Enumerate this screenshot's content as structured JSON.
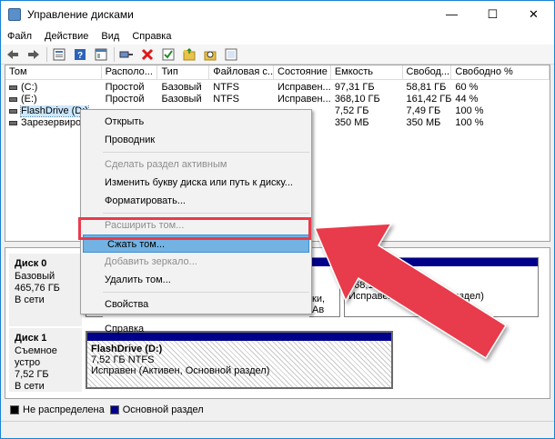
{
  "window": {
    "title": "Управление дисками",
    "minimize": "—",
    "maximize": "☐",
    "close": "✕"
  },
  "menu": [
    "Файл",
    "Действие",
    "Вид",
    "Справка"
  ],
  "toolbar_icons": [
    "back-icon",
    "forward-icon",
    "properties-icon",
    "help-icon",
    "console-icon",
    "connect-icon",
    "delete-icon",
    "check-icon",
    "folder-icon",
    "search-folder-icon",
    "refresh-icon"
  ],
  "table": {
    "headers": [
      "Том",
      "Располо...",
      "Тип",
      "Файловая с...",
      "Состояние",
      "Емкость",
      "Свобод...",
      "Свободно %"
    ],
    "rows": [
      {
        "volume": "(C:)",
        "layout": "Простой",
        "type": "Базовый",
        "fs": "NTFS",
        "status": "Исправен...",
        "capacity": "97,31 ГБ",
        "free": "58,81 ГБ",
        "free_pct": "60 %"
      },
      {
        "volume": "(E:)",
        "layout": "Простой",
        "type": "Базовый",
        "fs": "NTFS",
        "status": "Исправен...",
        "capacity": "368,10 ГБ",
        "free": "161,42 ГБ",
        "free_pct": "44 %"
      },
      {
        "volume": "FlashDrive (D:)",
        "layout": "",
        "type": "",
        "fs": "",
        "status": "",
        "capacity": "7,52 ГБ",
        "free": "7,49 ГБ",
        "free_pct": "100 %"
      },
      {
        "volume": "Зарезервирова",
        "layout": "",
        "type": "",
        "fs": "",
        "status": "",
        "capacity": "350 МБ",
        "free": "350 МБ",
        "free_pct": "100 %"
      }
    ]
  },
  "disks": [
    {
      "name": "Диск 0",
      "type": "Базовый",
      "size": "465,76 ГБ",
      "state": "В сети"
    },
    {
      "name": "Диск 1",
      "type": "Съемное устро",
      "size": "7,52 ГБ",
      "state": "В сети"
    }
  ],
  "partitions": {
    "e_drive": {
      "name": "(E:)",
      "size": "368,10 ГБ",
      "status": "Исправен (Основной раздел)"
    },
    "partial_text": "ки, Ав",
    "flash": {
      "name": "FlashDrive  (D:)",
      "size": "7,52 ГБ NTFS",
      "status": "Исправен (Активен, Основной раздел)"
    }
  },
  "legend": [
    {
      "label": "Не распределена",
      "color": "#000000"
    },
    {
      "label": "Основной раздел",
      "color": "#00008b"
    }
  ],
  "context_menu": {
    "open": "Открыть",
    "explorer": "Проводник",
    "mark_active": "Сделать раздел активным",
    "change_letter": "Изменить букву диска или путь к диску...",
    "format": "Форматировать...",
    "extend": "Расширить том...",
    "shrink": "Сжать том...",
    "mirror": "Добавить зеркало...",
    "delete": "Удалить том...",
    "properties": "Свойства",
    "help": "Справка"
  },
  "annotation_color": "#e83b4c"
}
